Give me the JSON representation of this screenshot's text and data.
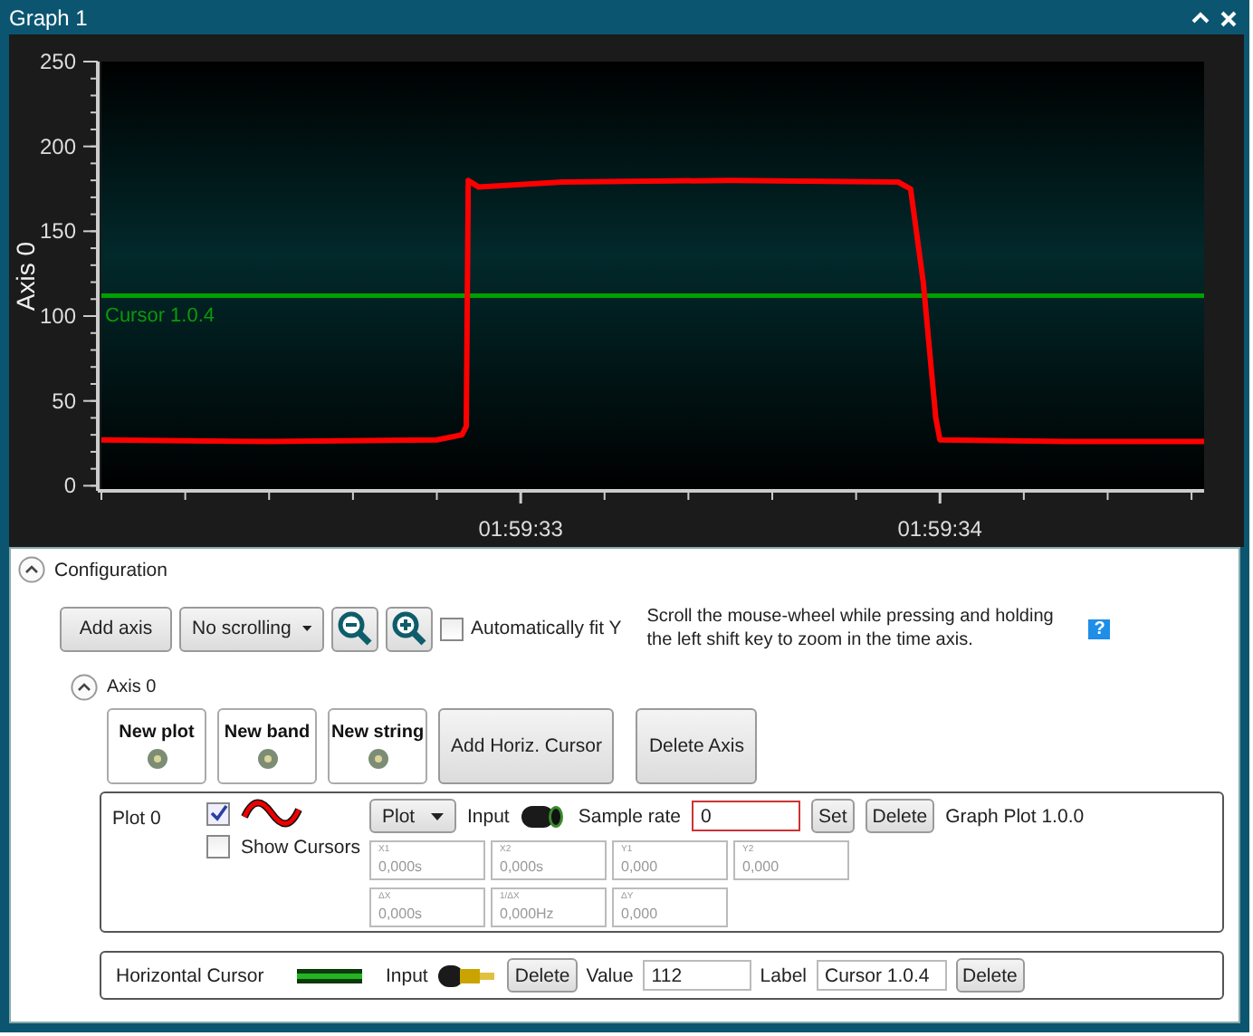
{
  "window": {
    "title": "Graph 1"
  },
  "chart": {
    "chart_data": {
      "type": "line",
      "ylabel": "Axis 0",
      "xlim": [
        7172.0,
        7174.63
      ],
      "ylim": [
        -3,
        250
      ],
      "yticks": [
        0,
        50,
        100,
        150,
        200,
        250
      ],
      "xticks": [
        {
          "value": 7173,
          "label": "01:59:33"
        },
        {
          "value": 7174,
          "label": "01:59:34"
        }
      ],
      "x": [
        7172.0,
        7172.4,
        7172.8,
        7172.86,
        7172.87,
        7172.875,
        7172.9,
        7173.1,
        7173.5,
        7173.9,
        7173.93,
        7173.96,
        7173.99,
        7174.0,
        7174.3,
        7174.63
      ],
      "series": [
        {
          "color": "#ff0000",
          "values": [
            27,
            26,
            27,
            30,
            35,
            180,
            176,
            179,
            180,
            179,
            175,
            120,
            40,
            27,
            26,
            26
          ]
        }
      ],
      "ref_lines": [
        {
          "axis": "y",
          "value": 112,
          "label": "Cursor 1.0.4"
        }
      ]
    }
  },
  "configuration": {
    "label": "Configuration",
    "expanded": true,
    "toolbar": {
      "add_axis": "Add axis",
      "scroll_mode": "No scrolling",
      "auto_fit": {
        "label": "Automatically fit Y",
        "checked": false
      },
      "hint": "Scroll the mouse-wheel while pressing and holding the left shift key to zoom in the time axis.",
      "help": "?"
    },
    "axis": {
      "label": "Axis 0",
      "expanded": true,
      "new_buttons": [
        "New plot",
        "New band",
        "New string"
      ],
      "add_cursor": "Add Horiz. Cursor",
      "delete_axis": "Delete Axis",
      "plot": {
        "name": "Plot 0",
        "visible": true,
        "show_cursors": {
          "label": "Show Cursors",
          "checked": false
        },
        "type": "Plot",
        "input_label": "Input",
        "sample_rate_label": "Sample rate",
        "sample_rate": "0",
        "set": "Set",
        "delete": "Delete",
        "title": "Graph Plot 1.0.0",
        "readouts": [
          [
            {
              "label": "X1",
              "value": "0,000s",
              "disabled": true
            },
            {
              "label": "X2",
              "value": "0,000s",
              "disabled": true
            },
            {
              "label": "Y1",
              "value": "0,000",
              "disabled": true
            },
            {
              "label": "Y2",
              "value": "0,000",
              "disabled": true
            }
          ],
          [
            {
              "label": "ΔX",
              "value": "0,000s",
              "disabled": true
            },
            {
              "label": "1/ΔX",
              "value": "0,000Hz",
              "disabled": true
            },
            {
              "label": "ΔY",
              "value": "0,000",
              "disabled": true
            }
          ]
        ]
      },
      "cursor": {
        "name": "Horizontal Cursor",
        "input_label": "Input",
        "delete": "Delete",
        "value_label": "Value",
        "value": "112",
        "label_label": "Label",
        "label": "Cursor 1.0.4",
        "delete_label": "Delete"
      }
    }
  }
}
